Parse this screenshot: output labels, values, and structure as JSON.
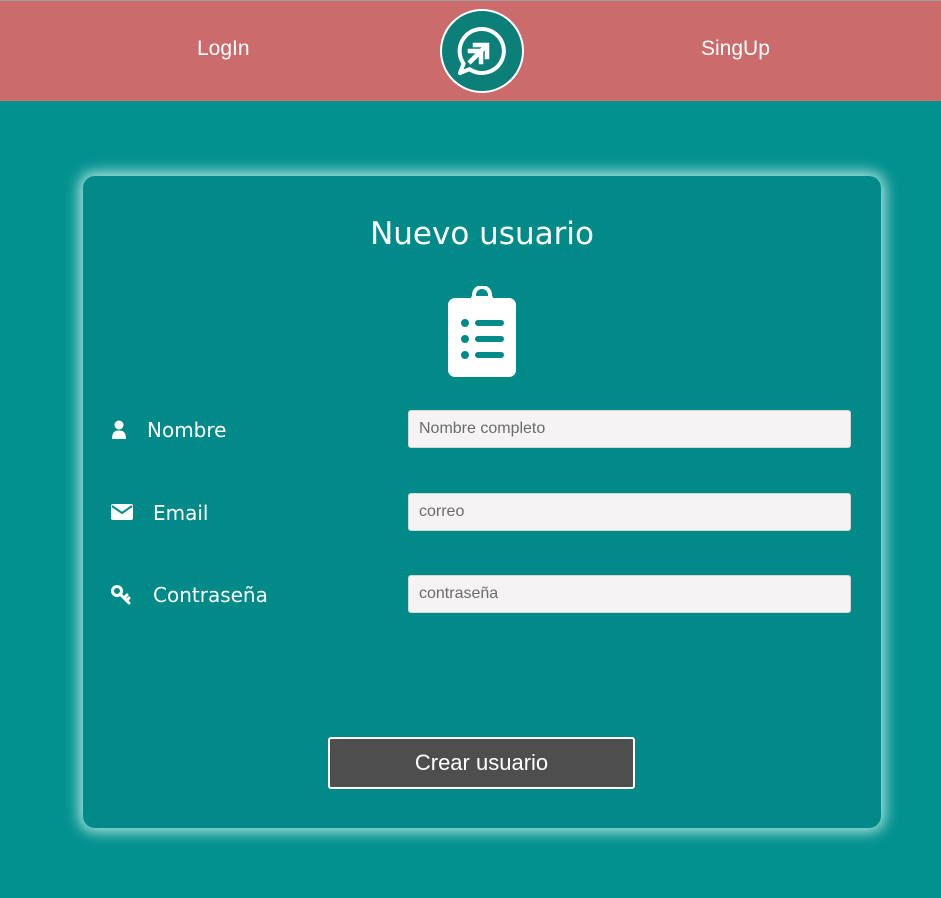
{
  "nav": {
    "login_label": "LogIn",
    "signup_label": "SingUp"
  },
  "form": {
    "title": "Nuevo usuario",
    "fields": [
      {
        "label": "Nombre",
        "placeholder": "Nombre completo",
        "value": "",
        "icon": "user-icon"
      },
      {
        "label": "Email",
        "placeholder": "correo",
        "value": "",
        "icon": "envelope-icon"
      },
      {
        "label": "Contraseña",
        "placeholder": "contraseña",
        "value": "",
        "icon": "key-icon"
      }
    ],
    "submit_label": "Crear usuario"
  },
  "colors": {
    "navbar": "#cb6b6c",
    "background": "#03918f",
    "card": "#028a88",
    "button": "#4e4e4e",
    "input": "#f5f3f3"
  }
}
